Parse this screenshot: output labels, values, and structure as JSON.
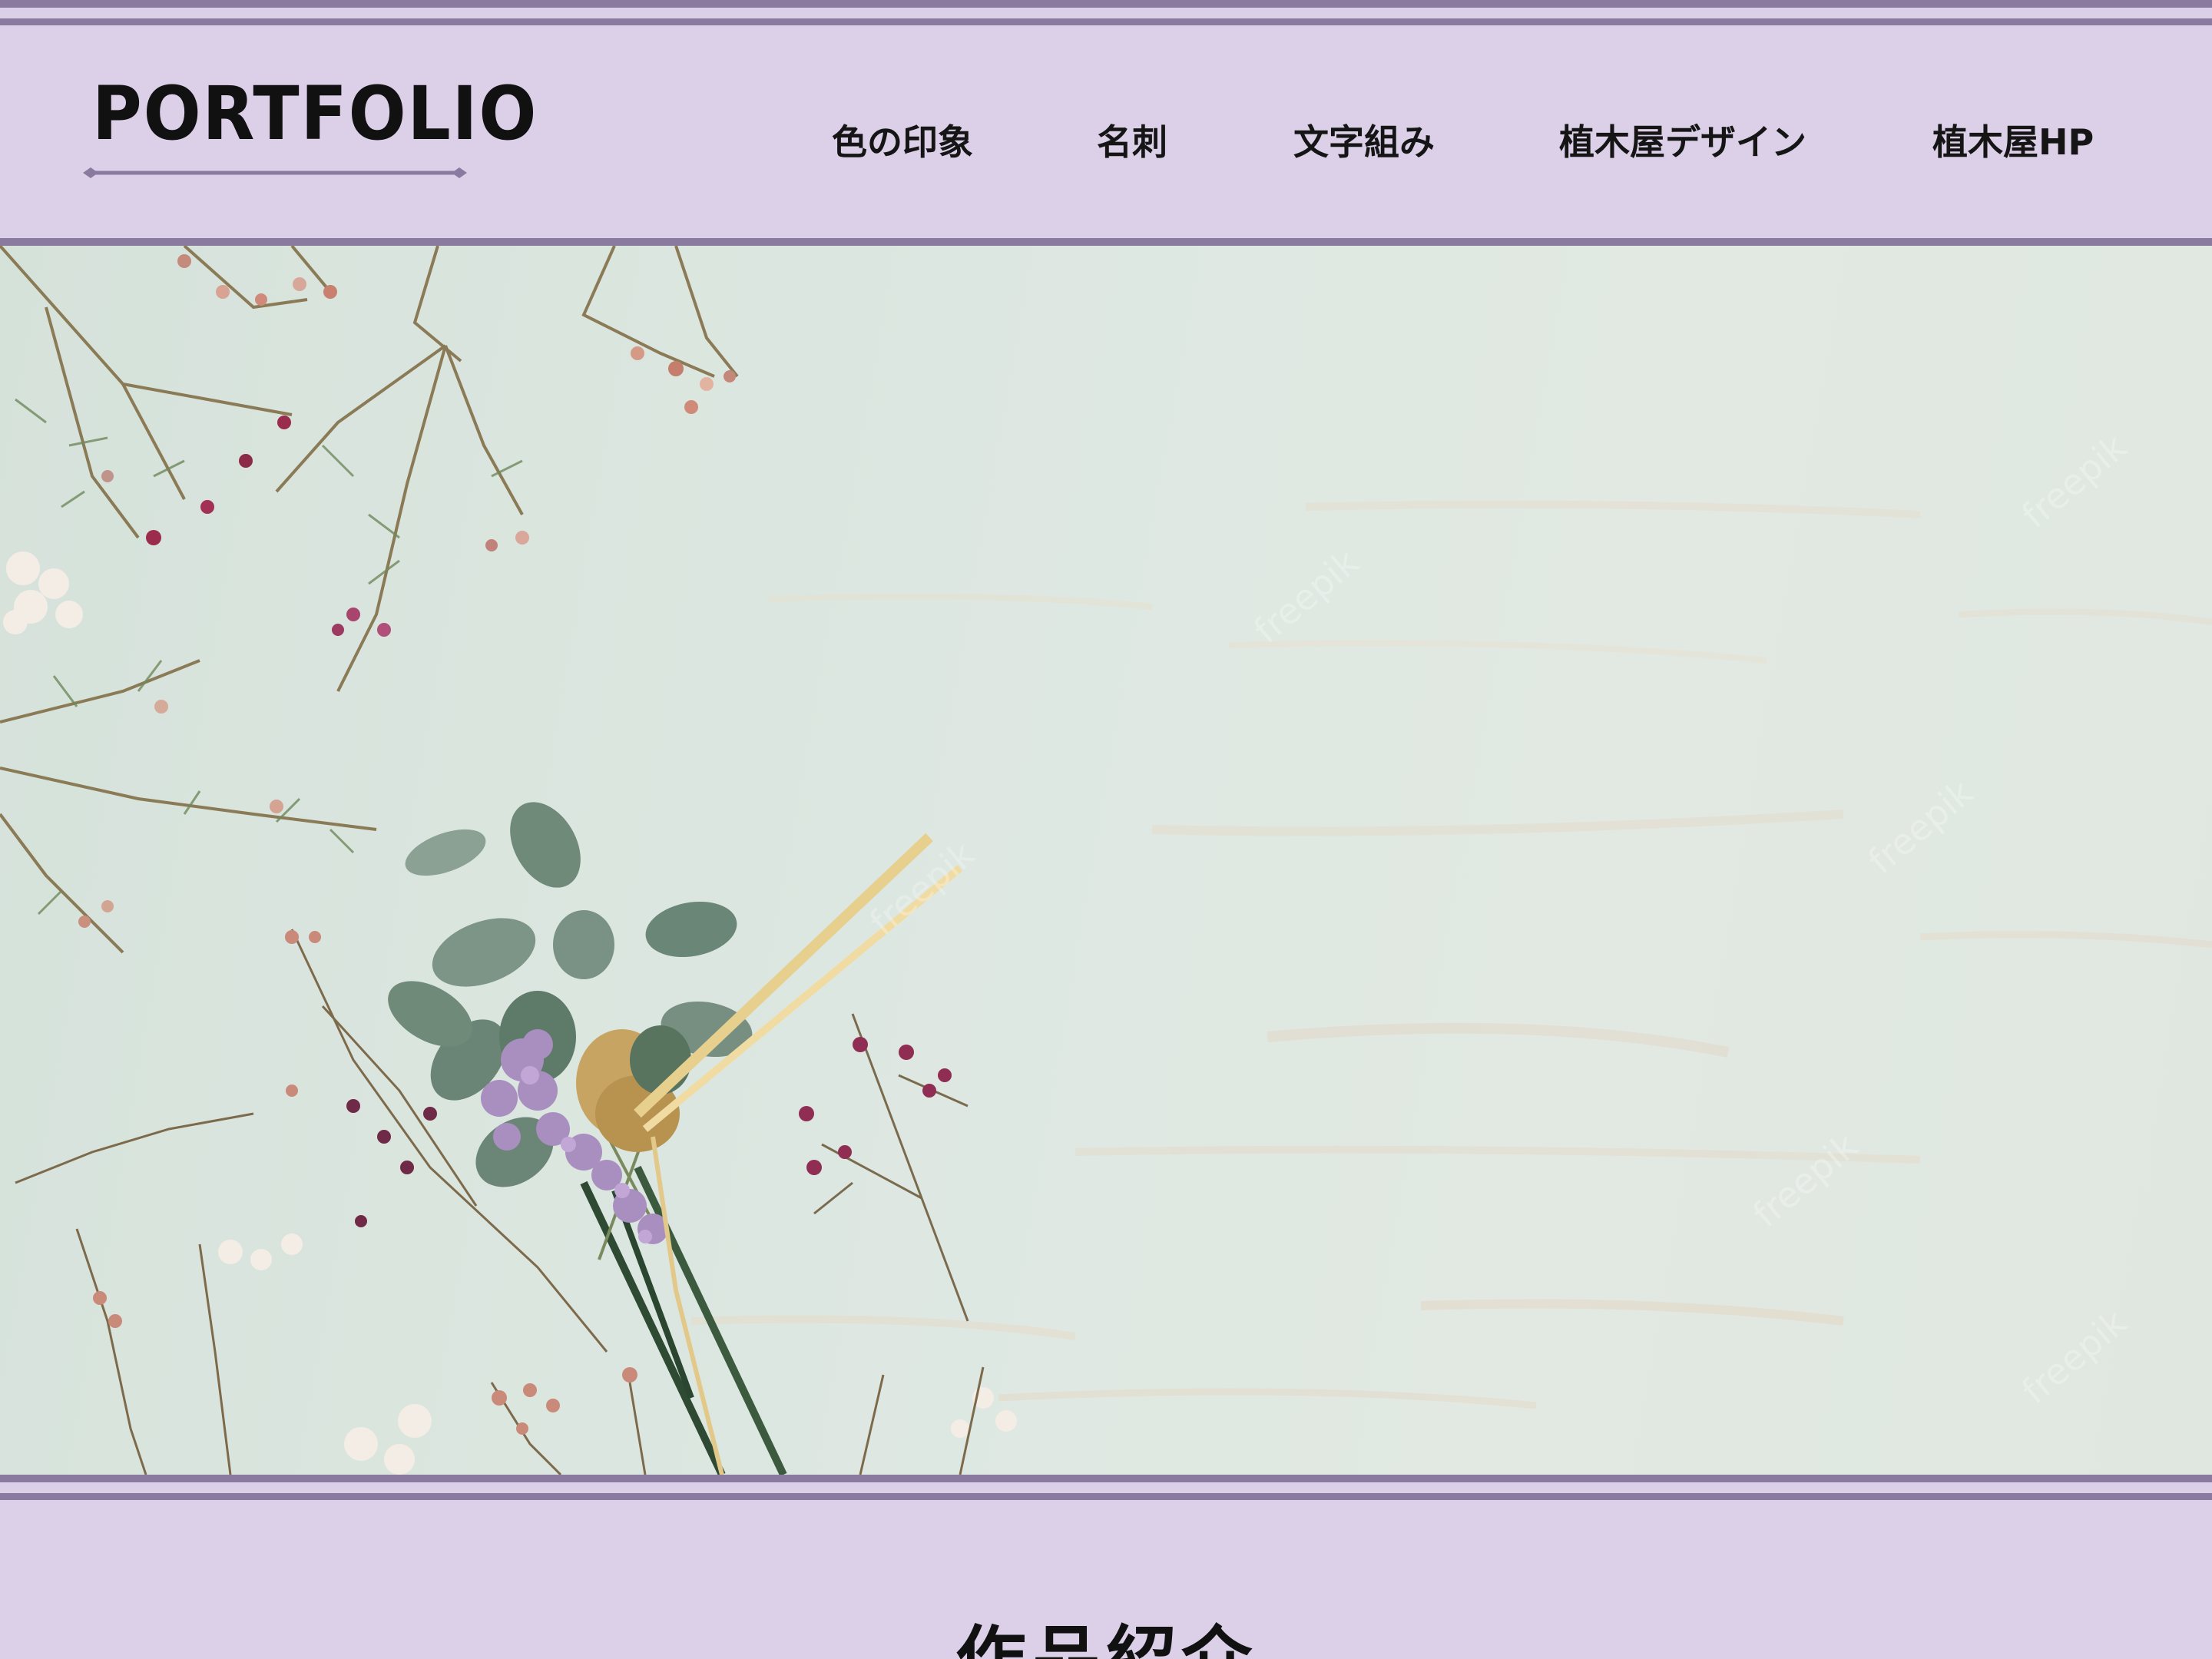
{
  "header": {
    "logo_text": "PORTFOLIO",
    "nav": [
      {
        "label": "色の印象"
      },
      {
        "label": "名刺"
      },
      {
        "label": "文字組み"
      },
      {
        "label": "植木屋デザイン"
      },
      {
        "label": "植木屋HP"
      }
    ]
  },
  "hero": {
    "image_subject": "dried flowers and eucalyptus bouquet on pale mint wooden background",
    "watermark": "freepik"
  },
  "section": {
    "title": "作品紹介"
  },
  "colors": {
    "header_bg": "#dccfe8",
    "border_line": "#8a7aa0",
    "hero_bg": "#dde7e1",
    "text": "#111111"
  }
}
